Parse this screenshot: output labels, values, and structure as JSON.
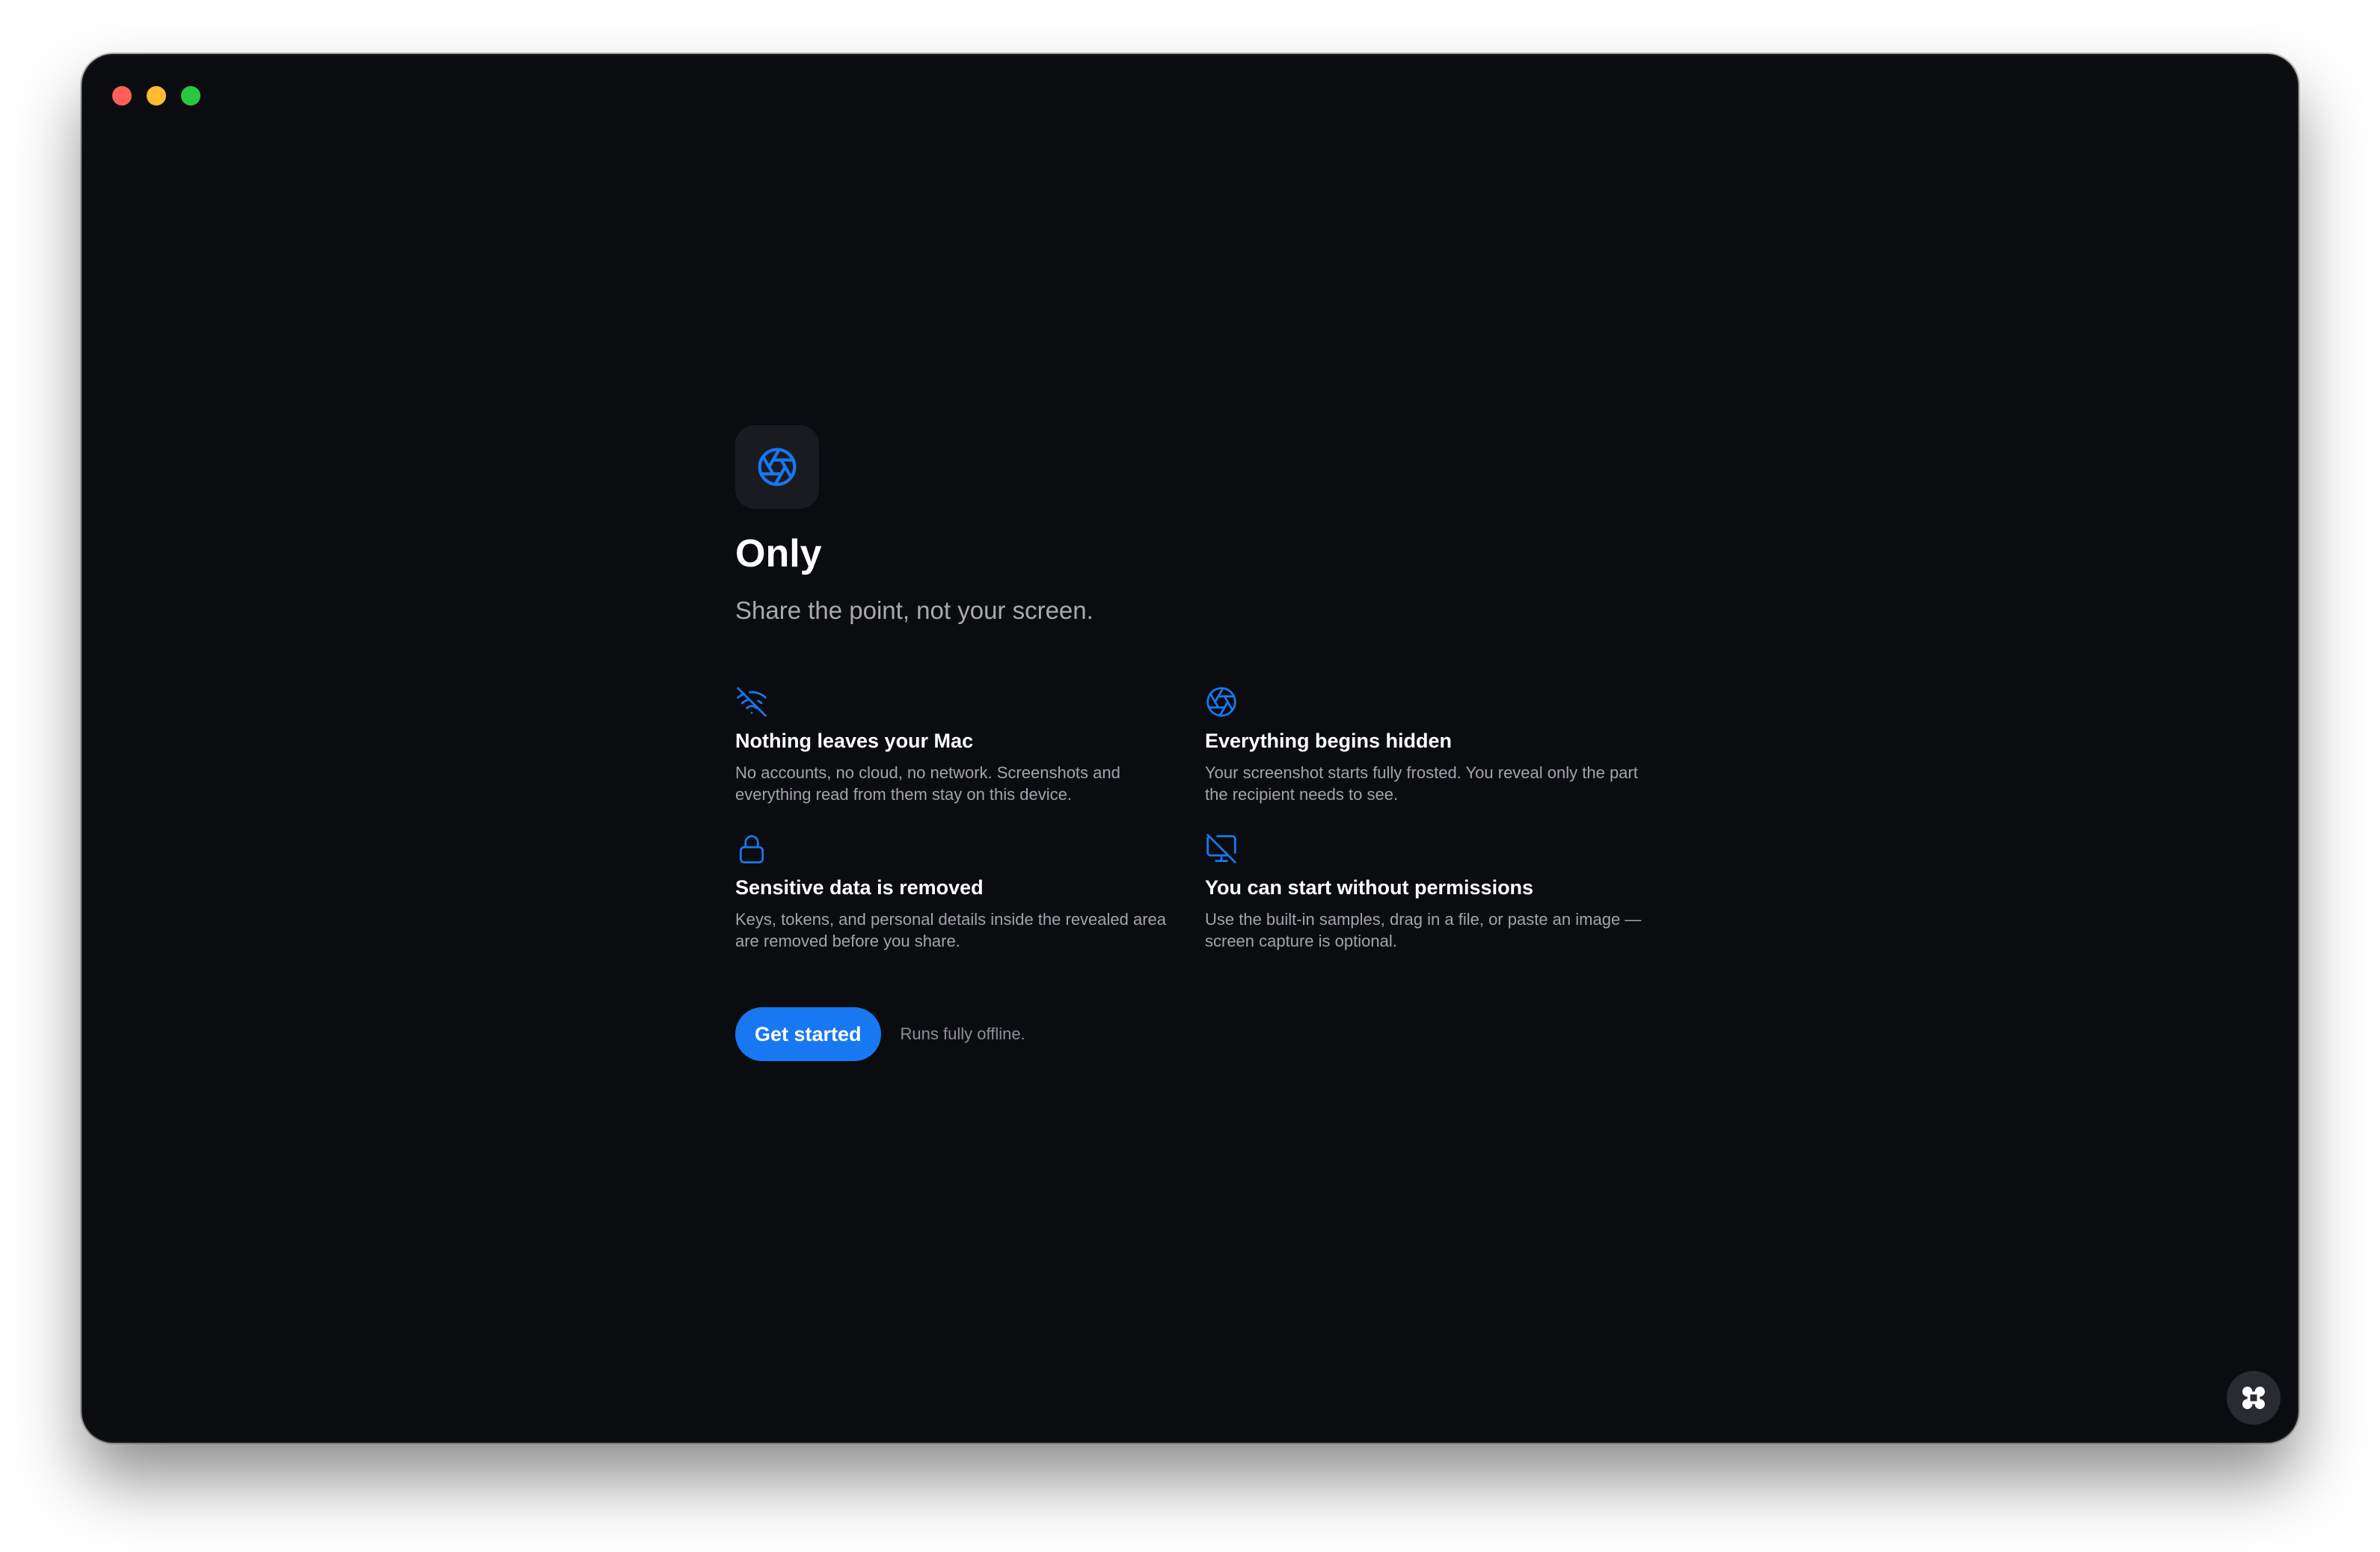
{
  "window": {
    "traffic_lights": {
      "close_color": "#ff5f57",
      "minimize_color": "#febc2e",
      "zoom_color": "#28c840"
    }
  },
  "app": {
    "icon": "aperture-icon",
    "title": "Only",
    "tagline": "Share the point, not your screen."
  },
  "features": [
    {
      "icon": "wifi-off-icon",
      "title": "Nothing leaves your Mac",
      "description": "No accounts, no cloud, no network. Screenshots and everything read from them stay on this device."
    },
    {
      "icon": "aperture-icon",
      "title": "Everything begins hidden",
      "description": "Your screenshot starts fully frosted. You reveal only the part the recipient needs to see."
    },
    {
      "icon": "lock-icon",
      "title": "Sensitive data is removed",
      "description": "Keys, tokens, and personal details inside the revealed area are removed before you share."
    },
    {
      "icon": "monitor-off-icon",
      "title": "You can start without permissions",
      "description": "Use the built-in samples, drag in a file, or paste an image — screen capture is optional."
    }
  ],
  "cta": {
    "button_label": "Get started",
    "note": "Runs fully offline."
  },
  "corner_button": {
    "icon": "command-icon"
  },
  "colors": {
    "accent": "#1778f2",
    "background": "#0b0c10"
  }
}
